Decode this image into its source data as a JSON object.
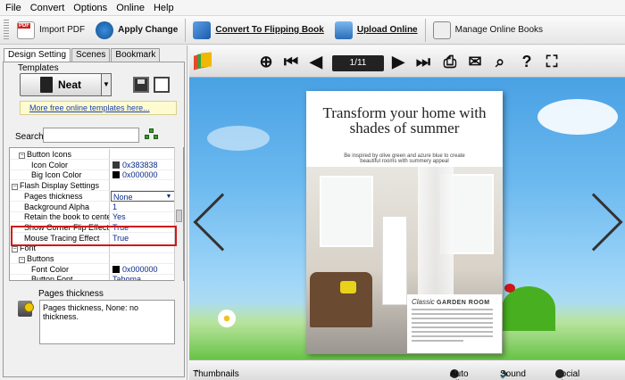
{
  "menu": [
    "File",
    "Convert",
    "Options",
    "Online",
    "Help"
  ],
  "toolbar": {
    "import_pdf": "Import PDF",
    "apply_change": "Apply Change",
    "convert": "Convert To Flipping Book",
    "upload": "Upload Online",
    "manage": "Manage Online Books"
  },
  "left_tabs": [
    "Design Setting",
    "Scenes",
    "Bookmark"
  ],
  "templates": {
    "label": "Templates",
    "selected": "Neat",
    "more_link": "More free online templates here..."
  },
  "search": {
    "label": "Search:",
    "value": ""
  },
  "properties": [
    {
      "name": "Button Icons",
      "value": "",
      "level": 1,
      "toggle": "⊟"
    },
    {
      "name": "Icon Color",
      "value": "0x383838",
      "level": 2,
      "swatch": "#383838"
    },
    {
      "name": "Big Icon Color",
      "value": "0x000000",
      "level": 2,
      "swatch": "#000000"
    },
    {
      "name": "Flash Display Settings",
      "value": "",
      "level": 0,
      "toggle": "⊟"
    },
    {
      "name": "Pages thickness",
      "value": "None",
      "level": 1,
      "selected": true
    },
    {
      "name": "Background Alpha",
      "value": "1",
      "level": 1
    },
    {
      "name": "Retain the book to center",
      "value": "Yes",
      "level": 1
    },
    {
      "name": "Show Corner Flip Effect",
      "value": "True",
      "level": 1
    },
    {
      "name": "Mouse Tracing Effect",
      "value": "True",
      "level": 1
    },
    {
      "name": "Font",
      "value": "",
      "level": 0,
      "toggle": "⊟"
    },
    {
      "name": "Buttons",
      "value": "",
      "level": 1,
      "toggle": "⊟"
    },
    {
      "name": "Font Color",
      "value": "0x000000",
      "level": 2,
      "swatch": "#000000"
    },
    {
      "name": "Button Font",
      "value": "Tahoma",
      "level": 2
    }
  ],
  "description": {
    "title": "Pages thickness",
    "text": "Pages thickness, None: no thickness."
  },
  "viewer": {
    "page_indicator": "1/11",
    "book_title": "Transform your home with shades of summer",
    "book_subtitle": "Be inspired by olive green and azure blue to create beautiful rooms with summery appeal",
    "info_title_italic": "Classic",
    "info_title_bold": "GARDEN ROOM",
    "status": {
      "thumbnails": "Thumbnails",
      "auto_flip": "Auto Flip",
      "sound_on": "Sound On",
      "social_share": "Social Share"
    }
  },
  "colors": {
    "link": "#1a3fb0",
    "highlight_border": "#d01818",
    "sky": "#3f9ae0"
  }
}
